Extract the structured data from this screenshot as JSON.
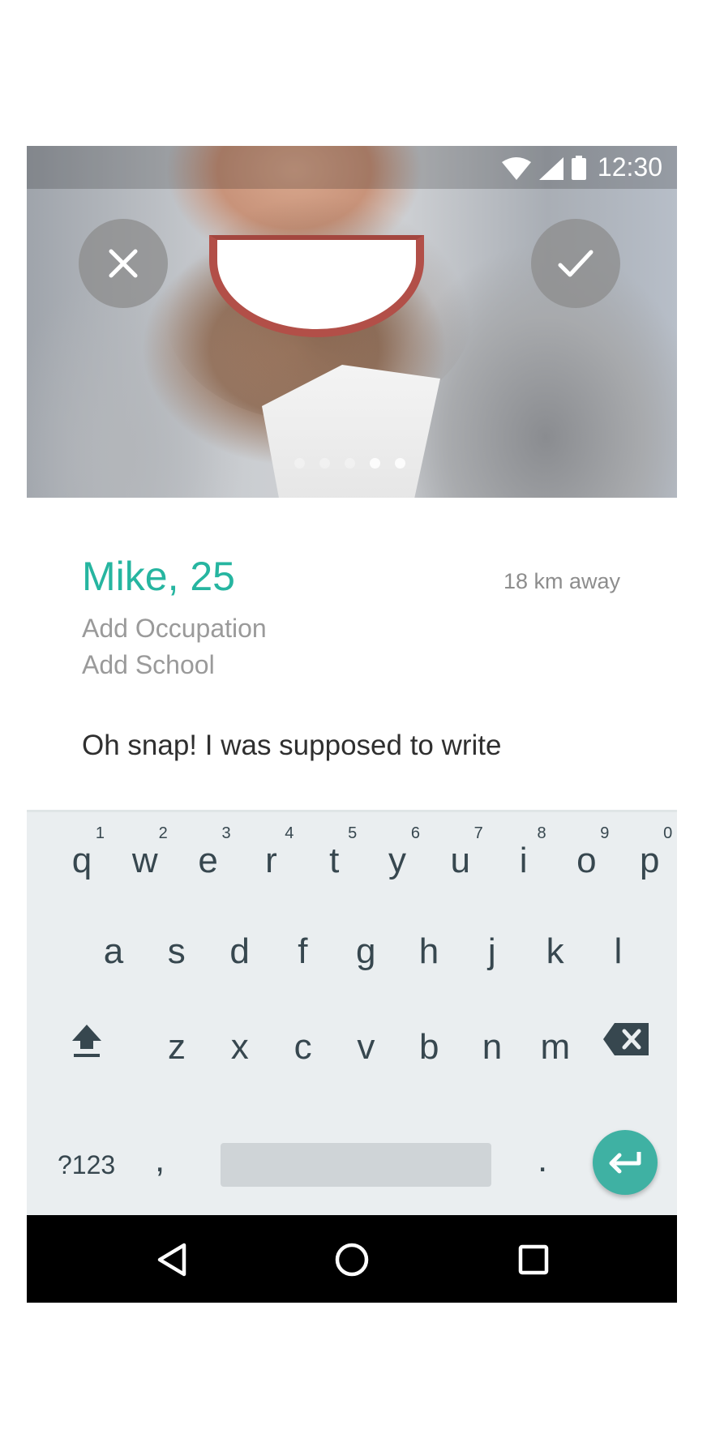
{
  "status_bar": {
    "time": "12:30"
  },
  "profile": {
    "name_age": "Mike, 25",
    "distance": "18 km away",
    "occupation_placeholder": "Add Occupation",
    "school_placeholder": "Add School",
    "bio_text": "Oh snap! I was supposed to write"
  },
  "photo_pager": {
    "count": 5,
    "active_index": 4
  },
  "keyboard": {
    "row1": [
      {
        "k": "q",
        "n": "1"
      },
      {
        "k": "w",
        "n": "2"
      },
      {
        "k": "e",
        "n": "3"
      },
      {
        "k": "r",
        "n": "4"
      },
      {
        "k": "t",
        "n": "5"
      },
      {
        "k": "y",
        "n": "6"
      },
      {
        "k": "u",
        "n": "7"
      },
      {
        "k": "i",
        "n": "8"
      },
      {
        "k": "o",
        "n": "9"
      },
      {
        "k": "p",
        "n": "0"
      }
    ],
    "row2": [
      "a",
      "s",
      "d",
      "f",
      "g",
      "h",
      "j",
      "k",
      "l"
    ],
    "row3": [
      "z",
      "x",
      "c",
      "v",
      "b",
      "n",
      "m"
    ],
    "symbols_label": "?123",
    "comma_label": ",",
    "period_label": "."
  },
  "colors": {
    "accent": "#26b5a0",
    "enter_button": "#3fb1a3",
    "keyboard_bg": "#eaeef0"
  },
  "icons": [
    "close-icon",
    "check-icon",
    "wifi-icon",
    "signal-icon",
    "battery-icon",
    "shift-icon",
    "backspace-icon",
    "enter-icon",
    "back-icon",
    "home-icon",
    "recents-icon"
  ]
}
